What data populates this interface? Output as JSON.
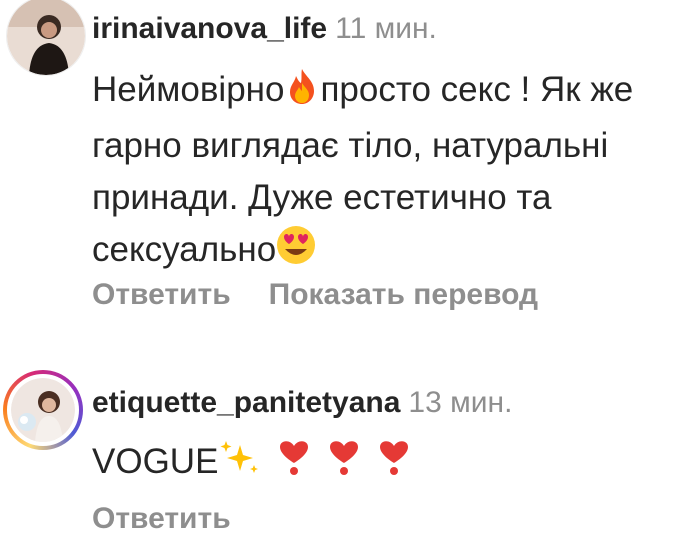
{
  "comments": [
    {
      "username": "irinaivanova_life",
      "time": "11 мин.",
      "text": [
        "Неймовірно",
        "просто секс ! Як же гарно виглядає тіло, натуральні принади. Дуже естетично та сексуально"
      ],
      "reply_label": "Ответить",
      "translate_label": "Показать перевод"
    },
    {
      "username": "etiquette_panitetyana",
      "time": "13 мин.",
      "text": [
        "VOGUE"
      ],
      "reply_label": "Ответить"
    }
  ],
  "icons": [
    "fire-emoji",
    "heart-eyes-emoji",
    "sparkles-emoji",
    "heart-exclamation-emoji"
  ],
  "colors": {
    "text": "#262626",
    "secondary": "#8e8e8e",
    "story_ring": "#d62976"
  }
}
